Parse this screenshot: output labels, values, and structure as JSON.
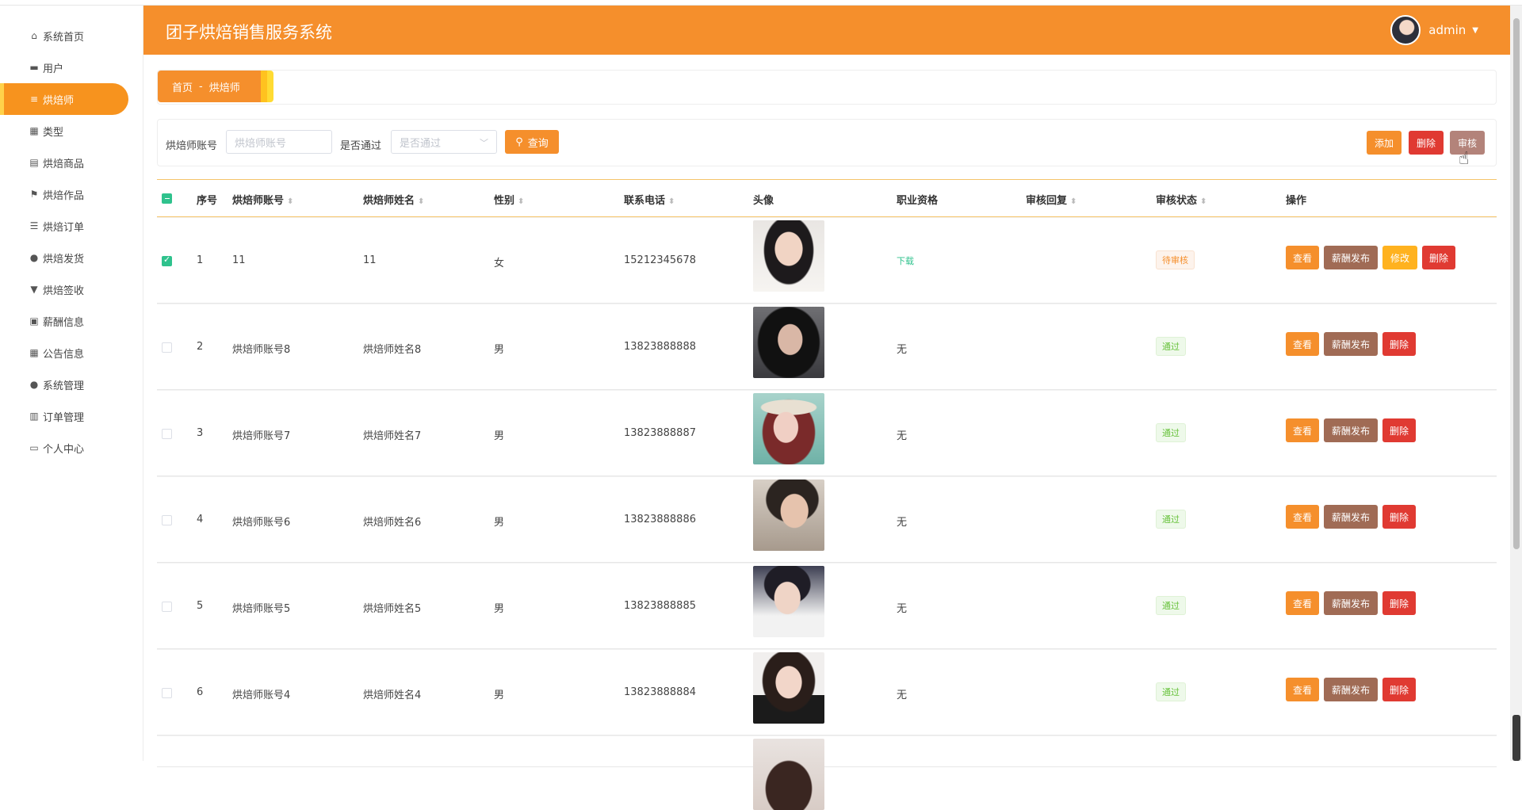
{
  "app": {
    "title": "团子烘焙销售服务系统",
    "user": "admin"
  },
  "sidebar": {
    "items": [
      {
        "label": "系统首页",
        "icon": "home-icon"
      },
      {
        "label": "用户",
        "icon": "monitor-icon"
      },
      {
        "label": "烘焙师",
        "icon": "list-icon",
        "active": true
      },
      {
        "label": "类型",
        "icon": "grid-icon"
      },
      {
        "label": "烘焙商品",
        "icon": "clipboard-icon"
      },
      {
        "label": "烘焙作品",
        "icon": "flag-icon"
      },
      {
        "label": "烘焙订单",
        "icon": "sliders-icon"
      },
      {
        "label": "烘焙发货",
        "icon": "user-icon"
      },
      {
        "label": "烘焙签收",
        "icon": "stamp-icon"
      },
      {
        "label": "薪酬信息",
        "icon": "clipboard-check-icon"
      },
      {
        "label": "公告信息",
        "icon": "grid-icon"
      },
      {
        "label": "系统管理",
        "icon": "user-icon"
      },
      {
        "label": "订单管理",
        "icon": "library-icon"
      },
      {
        "label": "个人中心",
        "icon": "card-icon"
      }
    ]
  },
  "breadcrumb": {
    "home": "首页",
    "separator": "-",
    "current": "烘焙师"
  },
  "search": {
    "account_label": "烘焙师账号",
    "account_placeholder": "烘焙师账号",
    "approved_label": "是否通过",
    "approved_placeholder": "是否通过",
    "query_label": "查询"
  },
  "toolbar": {
    "add_label": "添加",
    "delete_label": "删除",
    "audit_label": "审核"
  },
  "table": {
    "headers": {
      "index": "序号",
      "account": "烘焙师账号",
      "name": "烘焙师姓名",
      "gender": "性别",
      "phone": "联系电话",
      "avatar": "头像",
      "qualification": "职业资格",
      "reply": "审核回复",
      "status": "审核状态",
      "ops": "操作"
    },
    "ops": {
      "view": "查看",
      "pay": "薪酬发布",
      "edit": "修改",
      "delete": "删除"
    },
    "rows": [
      {
        "index": "1",
        "account": "11",
        "name": "11",
        "gender": "女",
        "phone": "15212345678",
        "qualification": "下载",
        "reply": "",
        "status": "待审核",
        "checked": true
      },
      {
        "index": "2",
        "account": "烘焙师账号8",
        "name": "烘焙师姓名8",
        "gender": "男",
        "phone": "13823888888",
        "qualification": "无",
        "reply": "",
        "status": "通过",
        "checked": false
      },
      {
        "index": "3",
        "account": "烘焙师账号7",
        "name": "烘焙师姓名7",
        "gender": "男",
        "phone": "13823888887",
        "qualification": "无",
        "reply": "",
        "status": "通过",
        "checked": false
      },
      {
        "index": "4",
        "account": "烘焙师账号6",
        "name": "烘焙师姓名6",
        "gender": "男",
        "phone": "13823888886",
        "qualification": "无",
        "reply": "",
        "status": "通过",
        "checked": false
      },
      {
        "index": "5",
        "account": "烘焙师账号5",
        "name": "烘焙师姓名5",
        "gender": "男",
        "phone": "13823888885",
        "qualification": "无",
        "reply": "",
        "status": "通过",
        "checked": false
      },
      {
        "index": "6",
        "account": "烘焙师账号4",
        "name": "烘焙师姓名4",
        "gender": "男",
        "phone": "13823888884",
        "qualification": "无",
        "reply": "",
        "status": "通过",
        "checked": false
      }
    ]
  },
  "colors": {
    "primary": "#f58f2c",
    "danger": "#e03a32",
    "audit": "#b3837a",
    "pay": "#a06b55",
    "edit": "#ffb21f",
    "success": "#67c23a"
  }
}
